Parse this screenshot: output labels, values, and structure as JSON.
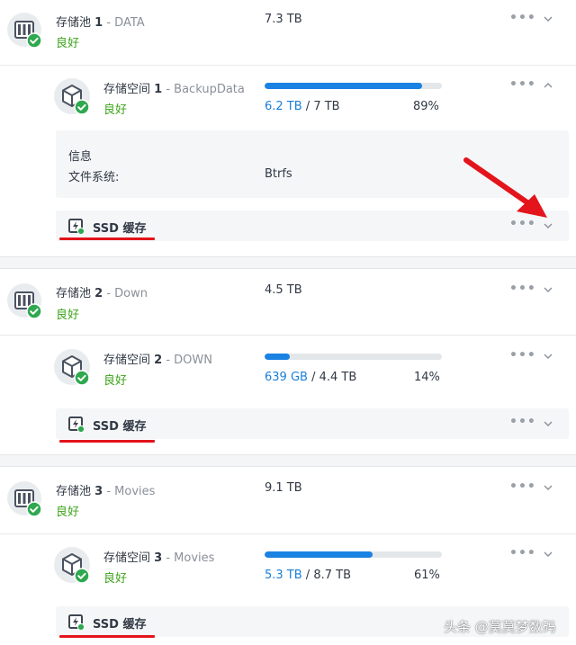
{
  "pools": [
    {
      "prefix": "存储池",
      "number": "1",
      "sep": " - ",
      "name": "DATA",
      "status": "良好",
      "size": "7.3 TB",
      "volume": {
        "prefix": "存储空间",
        "number": "1",
        "sep": " - ",
        "name": "BackupData",
        "status": "良好",
        "used": "6.2 TB",
        "slash": " / ",
        "total": "7 TB",
        "percent_label": "89%",
        "fill_fraction": 0.89
      },
      "info": {
        "title": "信息",
        "fs_label": "文件系统:",
        "fs_value": "Btrfs"
      },
      "ssd_label": "SSD 缓存"
    },
    {
      "prefix": "存储池",
      "number": "2",
      "sep": " - ",
      "name": "Down",
      "status": "良好",
      "size": "4.5 TB",
      "volume": {
        "prefix": "存储空间",
        "number": "2",
        "sep": " - ",
        "name": "DOWN",
        "status": "良好",
        "used": "639 GB",
        "slash": " / ",
        "total": "4.4 TB",
        "percent_label": "14%",
        "fill_fraction": 0.14
      },
      "ssd_label": "SSD 缓存"
    },
    {
      "prefix": "存储池",
      "number": "3",
      "sep": " - ",
      "name": "Movies",
      "status": "良好",
      "size": "9.1 TB",
      "volume": {
        "prefix": "存储空间",
        "number": "3",
        "sep": " - ",
        "name": "Movies",
        "status": "良好",
        "used": "5.3 TB",
        "slash": " / ",
        "total": "8.7 TB",
        "percent_label": "61%",
        "fill_fraction": 0.61
      },
      "ssd_label": "SSD 缓存"
    }
  ],
  "more_label": "•••",
  "watermark": "头条 @莫莫梦数码",
  "colors": {
    "good": "#3ca318",
    "bar_fill": "#1a82e2",
    "used_text": "#1a7fd8",
    "annotation_red": "#e3141b"
  }
}
